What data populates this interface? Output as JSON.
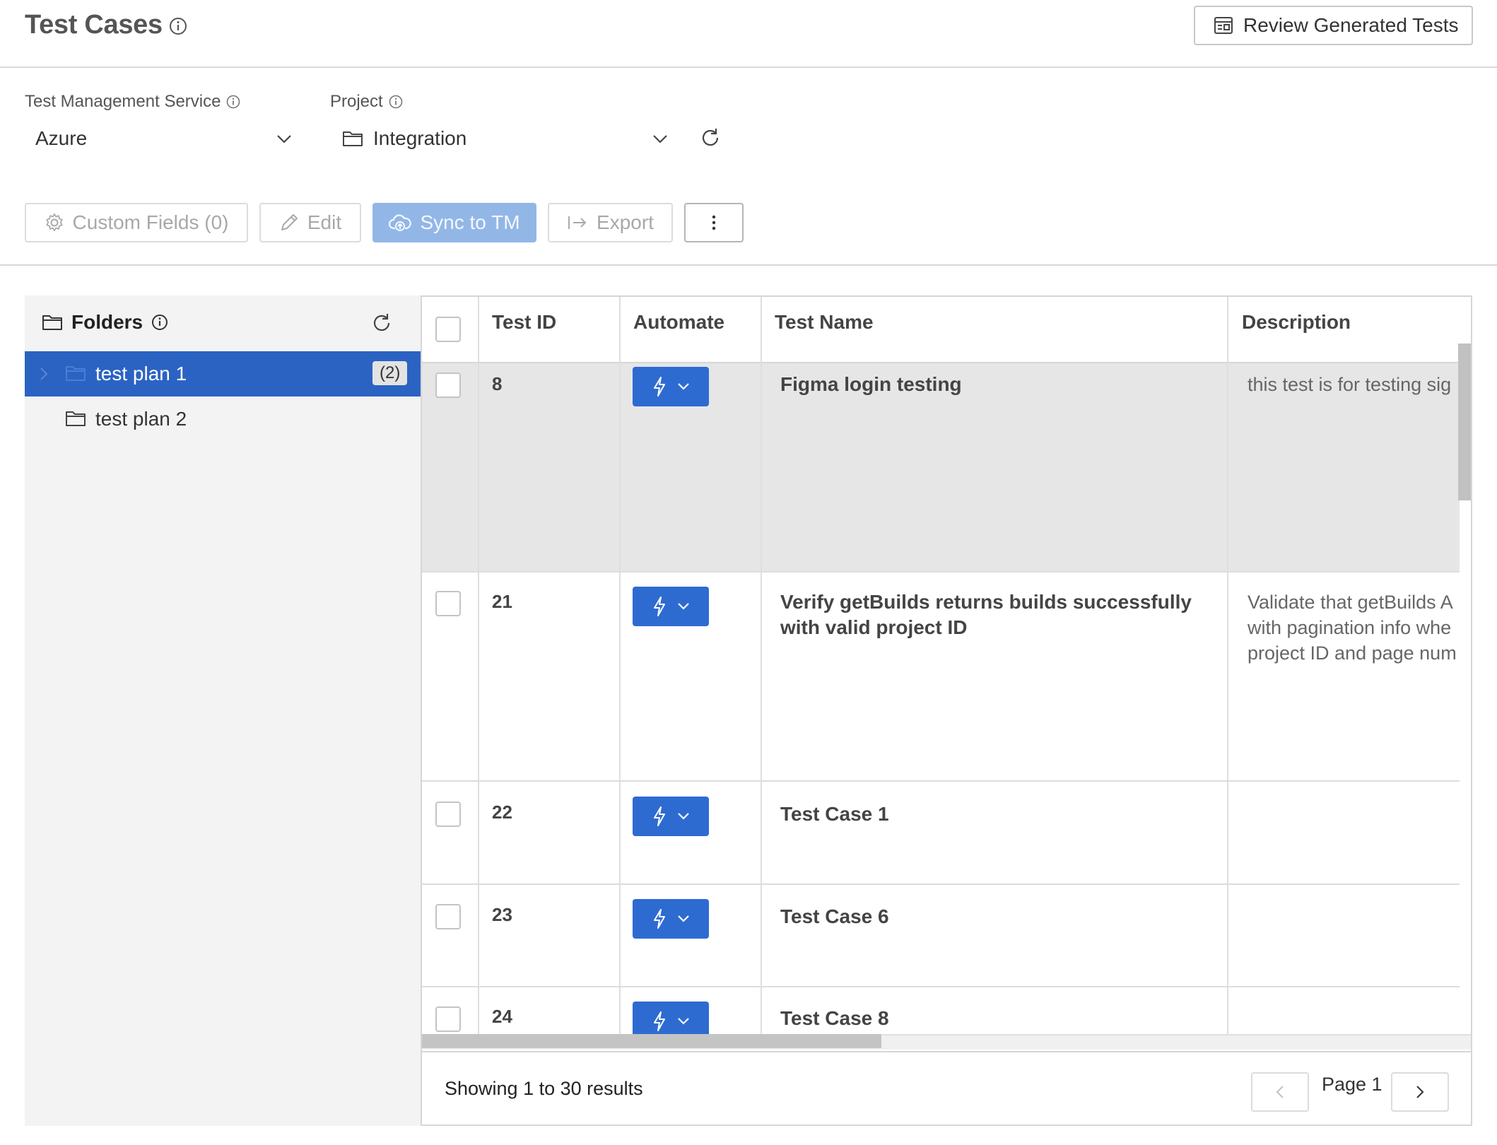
{
  "header": {
    "title": "Test Cases",
    "review_button": "Review Generated Tests"
  },
  "filters": {
    "service_label": "Test Management Service",
    "service_value": "Azure",
    "project_label": "Project",
    "project_value": "Integration"
  },
  "toolbar": {
    "custom_fields": "Custom Fields (0)",
    "edit": "Edit",
    "sync": "Sync to TM",
    "export": "Export"
  },
  "folders": {
    "title": "Folders",
    "items": [
      {
        "label": "test plan 1",
        "count": "(2)",
        "selected": true
      },
      {
        "label": "test plan 2",
        "selected": false
      }
    ]
  },
  "table": {
    "columns": [
      "Test ID",
      "Automate",
      "Test Name",
      "Description"
    ],
    "rows": [
      {
        "id": "8",
        "name": "Figma login testing",
        "description": [
          "this test is for testing sig"
        ]
      },
      {
        "id": "21",
        "name": "Verify getBuilds returns builds successfully with valid project ID",
        "description": [
          "Validate that getBuilds A",
          "with pagination info whe",
          "project ID and page num"
        ]
      },
      {
        "id": "22",
        "name": "Test Case 1",
        "description": []
      },
      {
        "id": "23",
        "name": "Test Case 6",
        "description": []
      },
      {
        "id": "24",
        "name": "Test Case 8",
        "description": []
      }
    ],
    "footer": {
      "showing": "Showing 1 to 30 results",
      "page": "Page 1"
    }
  },
  "colors": {
    "primary": "#2e6bd1",
    "selected_folder": "#2b63c3",
    "sync_disabled": "#92b7e6"
  }
}
